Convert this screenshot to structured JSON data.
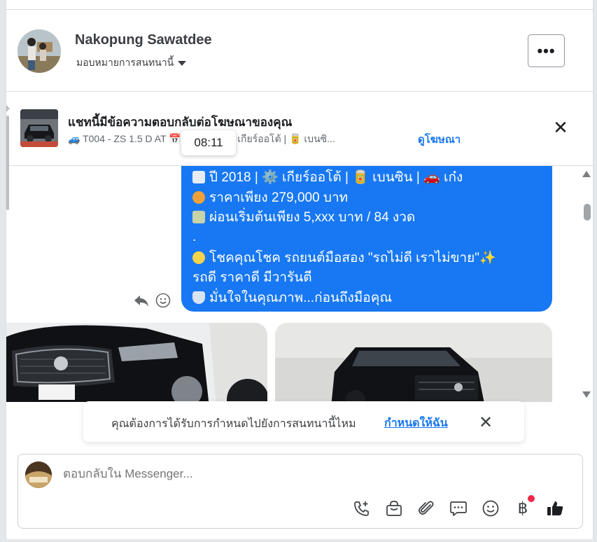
{
  "header": {
    "contact_name": "Nakopung Sawatdee",
    "assign_label": "มอบหมายการสนทนานี้",
    "more_label": "•••"
  },
  "ad_banner": {
    "title": "แชทนี้มีข้อความตอบกลับต่อโฆษณาของคุณ",
    "subtitle": "🚙 T004 - ZS 1.5 D AT  📅 ปี 2018 | ⚙️ เกียร์ออโต้ | 🥫 เบนซิ...",
    "link_label": "ดูโฆษณา",
    "close_label": "✕"
  },
  "tooltip": {
    "time": "08:11"
  },
  "message": {
    "lines": [
      "ปี 2018 | ⚙️ เกียร์ออโต้ | 🥫 เบนซิน | 🚗 เก๋ง",
      "ราคาเพียง 279,000 บาท",
      "ผ่อนเริ่มต้นเพียง 5,xxx บาท / 84 งวด",
      ".",
      "โชคคุณโชค รถยนต์มือสอง \"รถไม่ดี เราไม่ขาย\"✨",
      "รถดี ราคาดี มีวารันตี",
      "มั่นใจในคุณภาพ...ก่อนถึงมือคุณ"
    ]
  },
  "toast": {
    "text": "คุณต้องการได้รับการกำหนดไปยังการสนทนานี้ไหม",
    "link_label": "กำหนดให้ฉัน",
    "close_label": "✕"
  },
  "composer": {
    "placeholder": "ตอบกลับใน Messenger...",
    "baht_symbol": "฿"
  },
  "colors": {
    "bubble": "#1878f3",
    "link": "#1877f2",
    "notification_dot": "#f02849"
  }
}
